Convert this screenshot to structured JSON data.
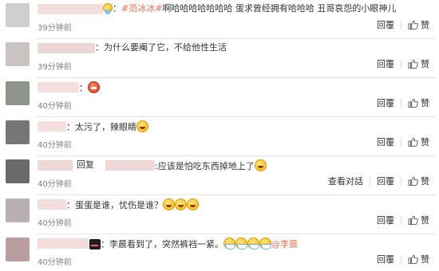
{
  "comments": [
    {
      "avatar_color": "#cfcfcf",
      "name_blur_color": "#f2dcdc",
      "prefix": "：",
      "mention": "#范冰冰#",
      "text": "啊哈哈哈哈哈哈哈  蛋求曾经拥有哈哈哈  丑哥哀怨的小眼神儿",
      "time": "39分钟前",
      "reply_label": "回覆",
      "like_label": "赞",
      "emoji": [
        "sweat-emoji"
      ]
    },
    {
      "avatar_color": "#c9c4c1",
      "name_blur_color": "#ecd6d6",
      "prefix": "：",
      "text": "为什么要阉了它，不给他性生活",
      "time": "39分钟前",
      "reply_label": "回覆",
      "like_label": "赞"
    },
    {
      "avatar_color": "#8f948d",
      "name_blur_color": "#f4dede",
      "prefix": "：",
      "time": "40分钟前",
      "reply_label": "回覆",
      "like_label": "赞",
      "emoji": [
        "angry-emoji"
      ]
    },
    {
      "avatar_color": "#767676",
      "name_blur_color": "#f4dede",
      "prefix": "：",
      "text": "太污了，辣眼睛",
      "time": "40分钟前",
      "reply_label": "回覆",
      "like_label": "赞",
      "emoji": [
        "laugh-cry-emoji"
      ]
    },
    {
      "avatar_color": "#6a6a6a",
      "name_blur_color": "#f0d8d8",
      "reply_word": "回复",
      "reply_target_blur_color": "#f0d8d8",
      "text": ":应该是怕吃东西掉地上了",
      "time": "40分钟前",
      "view_conversation_label": "查看对話",
      "reply_label": "回覆",
      "like_label": "赞",
      "emoji": [
        "laugh-cry-emoji"
      ]
    },
    {
      "avatar_color": "#b8b0b2",
      "name_blur_color": "#f3dcdc",
      "prefix": "：",
      "text": "蛋蛋是谁，忧伤是谁？",
      "time": "40分钟前",
      "reply_label": "回覆",
      "like_label": "赞",
      "emoji": [
        "laugh-cry-emoji",
        "laugh-cry-emoji",
        "laugh-cry-emoji"
      ]
    },
    {
      "avatar_color": "#b89ea0",
      "name_blur_color": "#f3dcdc",
      "prefix": "：",
      "text": "李晨看到了，突然裤裆一紧。",
      "mention": "@李晨",
      "time": "40分钟前",
      "reply_label": "回覆",
      "like_label": "赞",
      "emoji": [
        "doge-emoji",
        "mask-emoji",
        "mask-emoji",
        "mask-emoji",
        "mask-emoji"
      ]
    }
  ],
  "colors": {
    "link": "#eb7350",
    "time": "#808080",
    "divider": "#e3e3e3"
  }
}
